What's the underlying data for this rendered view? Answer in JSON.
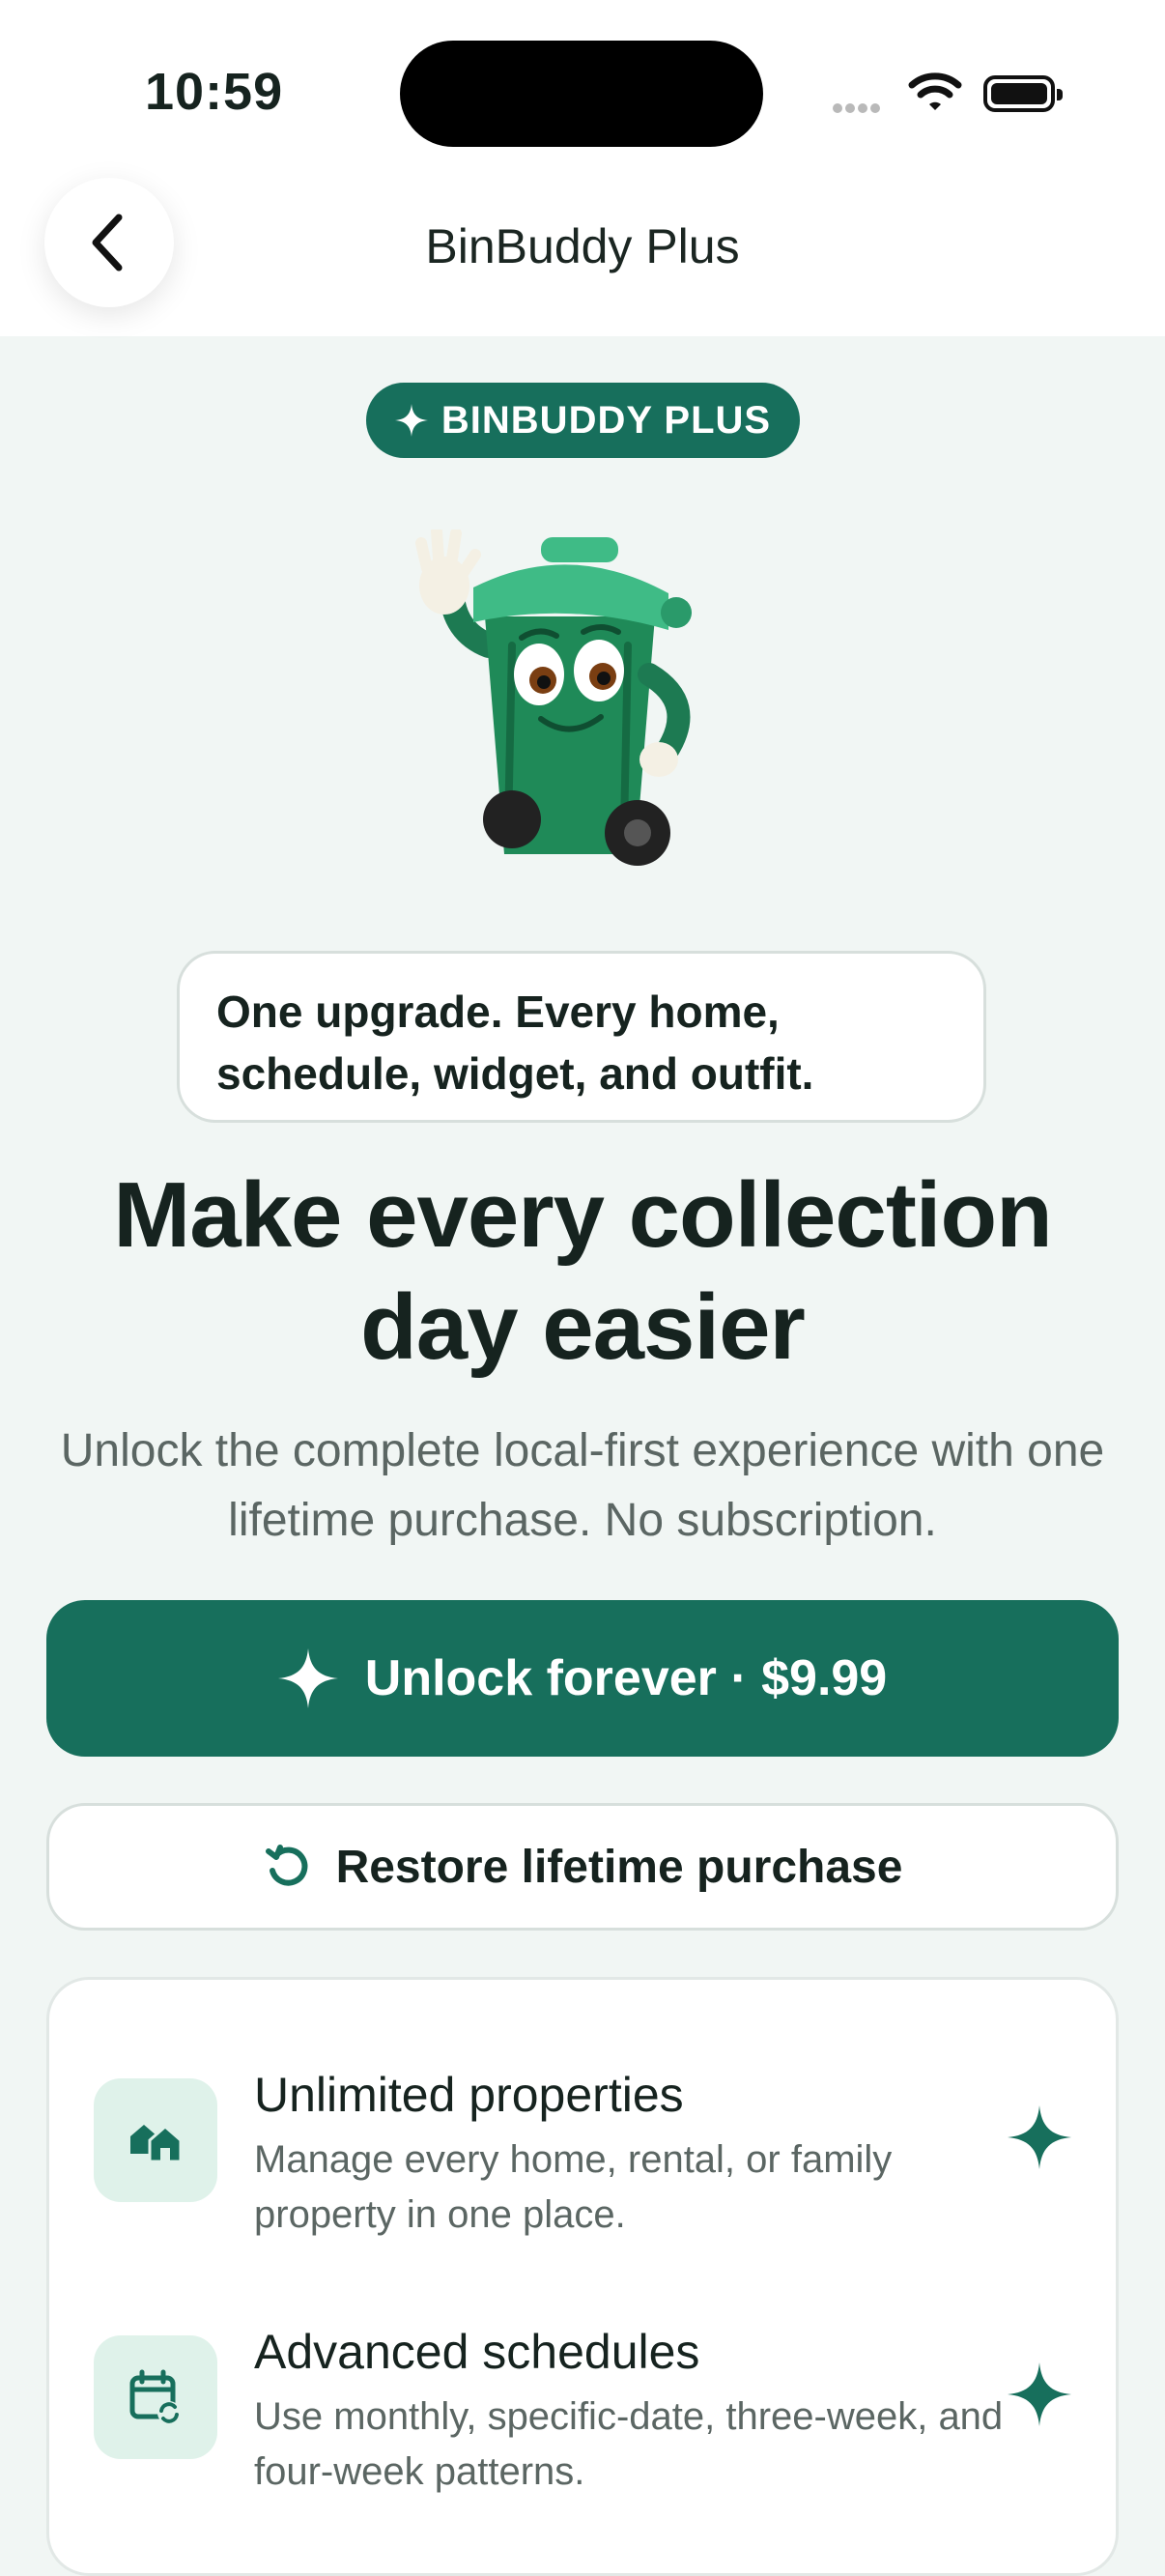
{
  "status": {
    "time": "10:59"
  },
  "nav": {
    "title": "BinBuddy Plus",
    "back_icon": "chevron-left-icon"
  },
  "badge": {
    "label": "BINBUDDY PLUS"
  },
  "tagline": "One upgrade. Every home, schedule, widget, and outfit.",
  "headline": "Make every collection day easier",
  "subtitle": "Unlock the complete local-first experience with one lifetime purchase. No subscription.",
  "unlock_button": {
    "label": "Unlock forever · $9.99"
  },
  "restore_button": {
    "label": "Restore lifetime purchase"
  },
  "features": [
    {
      "title": "Unlimited properties",
      "description": "Manage every home, rental, or family property in one place.",
      "icon": "houses-icon"
    },
    {
      "title": "Advanced schedules",
      "description": "Use monthly, specific-date, three-week, and four-week patterns.",
      "icon": "calendar-sync-icon"
    }
  ],
  "colors": {
    "accent": "#176f5c",
    "background": "#f1f6f4",
    "icon_bg": "#dff2ea"
  }
}
